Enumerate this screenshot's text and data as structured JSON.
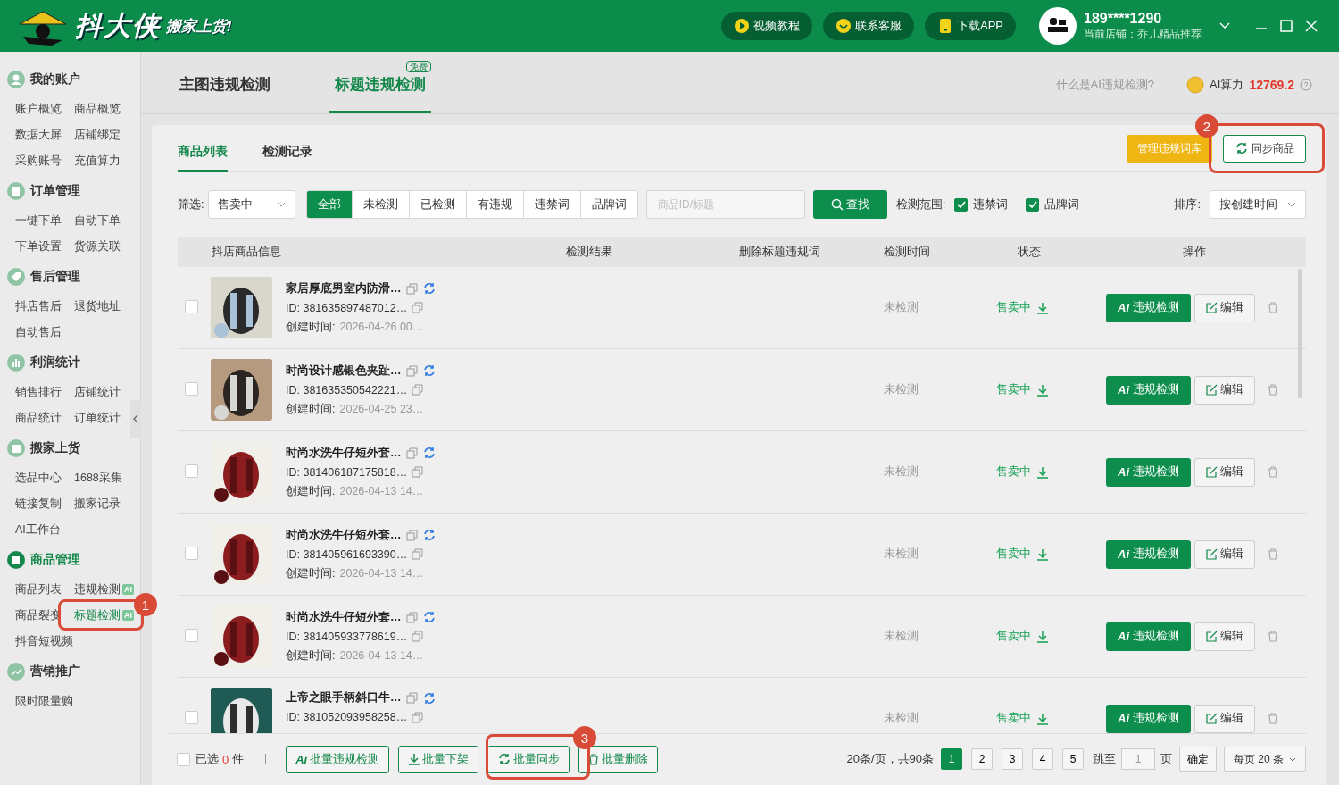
{
  "header": {
    "logo_text": "抖大侠",
    "slogan": "搬家上货!",
    "buttons": [
      {
        "label": "视频教程",
        "kind": "video"
      },
      {
        "label": "联系客服",
        "kind": "chat"
      },
      {
        "label": "下载APP",
        "kind": "app"
      }
    ],
    "account": {
      "phone": "189****1290",
      "store": "当前店铺：乔儿精品推荐"
    }
  },
  "sidebar": {
    "sections": [
      {
        "title": "我的账户",
        "active": false,
        "items": [
          {
            "label": "账户概览",
            "selected": false
          },
          {
            "label": "商品概览",
            "selected": false
          },
          {
            "label": "数据大屏",
            "selected": false
          },
          {
            "label": "店铺绑定",
            "selected": false
          },
          {
            "label": "采购账号",
            "selected": false
          },
          {
            "label": "充值算力",
            "selected": false
          }
        ]
      },
      {
        "title": "订单管理",
        "active": false,
        "items": [
          {
            "label": "一键下单",
            "selected": false
          },
          {
            "label": "自动下单",
            "selected": false
          },
          {
            "label": "下单设置",
            "selected": false
          },
          {
            "label": "货源关联",
            "selected": false
          }
        ]
      },
      {
        "title": "售后管理",
        "active": false,
        "items": [
          {
            "label": "抖店售后",
            "selected": false
          },
          {
            "label": "退货地址",
            "selected": false
          },
          {
            "label": "自动售后",
            "selected": false
          }
        ]
      },
      {
        "title": "利润统计",
        "active": false,
        "items": [
          {
            "label": "销售排行",
            "selected": false
          },
          {
            "label": "店铺统计",
            "selected": false
          },
          {
            "label": "商品统计",
            "selected": false
          },
          {
            "label": "订单统计",
            "selected": false
          }
        ]
      },
      {
        "title": "搬家上货",
        "active": false,
        "items": [
          {
            "label": "选品中心",
            "selected": false
          },
          {
            "label": "1688采集",
            "selected": false
          },
          {
            "label": "链接复制",
            "selected": false
          },
          {
            "label": "搬家记录",
            "selected": false
          },
          {
            "label": "AI工作台",
            "selected": false
          }
        ]
      },
      {
        "title": "商品管理",
        "active": true,
        "items": [
          {
            "label": "商品列表",
            "selected": false
          },
          {
            "label": "违规检测",
            "selected": false,
            "badge": "AI"
          },
          {
            "label": "商品裂变",
            "selected": false
          },
          {
            "label": "标题检测",
            "selected": true,
            "badge": "AI"
          },
          {
            "label": "抖音短视频",
            "selected": false
          }
        ]
      },
      {
        "title": "营销推广",
        "active": false,
        "items": [
          {
            "label": "限时限量购",
            "selected": false
          }
        ]
      }
    ]
  },
  "page_tabs": [
    {
      "label": "主图违规检测",
      "selected": false
    },
    {
      "label": "标题违规检测",
      "selected": true,
      "badge": "免费"
    }
  ],
  "top_info": {
    "help_link": "什么是AI违规检测?",
    "power_label": "AI算力",
    "power_value": "12769.2"
  },
  "card_tabs": [
    {
      "label": "商品列表",
      "selected": true
    },
    {
      "label": "检测记录",
      "selected": false
    }
  ],
  "card_buttons": [
    {
      "label": "管理违规词库",
      "kind": "warning"
    },
    {
      "label": "同步商品",
      "kind": "sync"
    }
  ],
  "filter": {
    "label": "筛选:",
    "status_value": "售卖中",
    "segments": [
      {
        "label": "全部",
        "selected": true
      },
      {
        "label": "未检测",
        "selected": false
      },
      {
        "label": "已检测",
        "selected": false
      },
      {
        "label": "有违规",
        "selected": false
      },
      {
        "label": "违禁词",
        "selected": false
      },
      {
        "label": "品牌词",
        "selected": false
      }
    ],
    "search_placeholder": "商品ID/标题",
    "search_button": "查找",
    "range_label": "检测范围:",
    "range_options": [
      {
        "label": "违禁词",
        "checked": true
      },
      {
        "label": "品牌词",
        "checked": true
      }
    ],
    "sort_label": "排序:",
    "sort_value": "按创建时间"
  },
  "table": {
    "columns": [
      "抖店商品信息",
      "检测结果",
      "删除标题违规词",
      "检测时间",
      "状态",
      "操作"
    ],
    "rows": [
      {
        "checked": false,
        "title": "家居厚底男室内防滑…",
        "id": "ID: 381635897487012…",
        "created_label": "创建时间:",
        "created": "2026-04-26 00…",
        "result": "未检测",
        "status": "售卖中",
        "ai_mark": "Ai",
        "action": "违规检测",
        "edit": "编辑"
      },
      {
        "checked": false,
        "title": "时尚设计感银色夹趾…",
        "id": "ID: 381635350542221…",
        "created_label": "创建时间:",
        "created": "2026-04-25 23…",
        "result": "未检测",
        "status": "售卖中",
        "ai_mark": "Ai",
        "action": "违规检测",
        "edit": "编辑"
      },
      {
        "checked": false,
        "title": "时尚水洗牛仔短外套…",
        "id": "ID: 381406187175818…",
        "created_label": "创建时间:",
        "created": "2026-04-13 14…",
        "result": "未检测",
        "status": "售卖中",
        "ai_mark": "Ai",
        "action": "违规检测",
        "edit": "编辑"
      },
      {
        "checked": false,
        "title": "时尚水洗牛仔短外套…",
        "id": "ID: 381405961693390…",
        "created_label": "创建时间:",
        "created": "2026-04-13 14…",
        "result": "未检测",
        "status": "售卖中",
        "ai_mark": "Ai",
        "action": "违规检测",
        "edit": "编辑"
      },
      {
        "checked": false,
        "title": "时尚水洗牛仔短外套…",
        "id": "ID: 381405933778619…",
        "created_label": "创建时间:",
        "created": "2026-04-13 14…",
        "result": "未检测",
        "status": "售卖中",
        "ai_mark": "Ai",
        "action": "违规检测",
        "edit": "编辑"
      },
      {
        "checked": false,
        "title": "上帝之眼手柄斜口牛…",
        "id": "ID: 381052093958258…",
        "result": "未检测",
        "status": "售卖中",
        "ai_mark": "Ai",
        "action": "违规检测",
        "edit": "编辑"
      }
    ]
  },
  "footer": {
    "checked": false,
    "selected_label": "已选",
    "selected_count": "0",
    "selected_unit": "件",
    "buttons": [
      {
        "label": "批量违规检测",
        "kind": "ai",
        "ai_mark": "Ai"
      },
      {
        "label": "批量下架",
        "kind": "down"
      },
      {
        "label": "批量同步",
        "kind": "sync"
      },
      {
        "label": "批量删除",
        "kind": "delete"
      }
    ],
    "page_info": "20条/页，共90条",
    "pages": [
      {
        "label": "1",
        "selected": true
      },
      {
        "label": "2",
        "selected": false
      },
      {
        "label": "3",
        "selected": false
      },
      {
        "label": "4",
        "selected": false
      },
      {
        "label": "5",
        "selected": false
      }
    ],
    "jump_label": "跳至",
    "jump_value": "1",
    "page_unit": "页",
    "confirm": "确定",
    "page_size": "每页 20 条"
  },
  "annotations": [
    {
      "number": "1"
    },
    {
      "number": "2"
    },
    {
      "number": "3"
    }
  ]
}
